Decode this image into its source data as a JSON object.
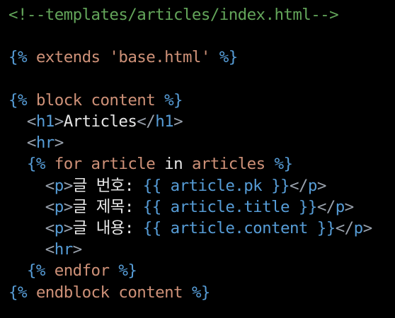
{
  "colors": {
    "background": "#000000",
    "comment": "#63a55a",
    "template_keyword": "#569cd6",
    "template_variable": "#ce9178",
    "html_tag": "#569cd6",
    "tag_bracket": "#9aa2ad",
    "plain_text": "#e6e6e6"
  },
  "code": {
    "lines": [
      {
        "tokens": [
          {
            "t": "<!--templates/articles/index.html-->",
            "k": "comment"
          }
        ]
      },
      {
        "tokens": []
      },
      {
        "tokens": [
          {
            "t": "{%",
            "k": "kw"
          },
          {
            "t": " extends ",
            "k": "var"
          },
          {
            "t": "'base.html'",
            "k": "var"
          },
          {
            "t": " %}",
            "k": "kw"
          }
        ]
      },
      {
        "tokens": []
      },
      {
        "tokens": [
          {
            "t": "{%",
            "k": "kw"
          },
          {
            "t": " block ",
            "k": "var"
          },
          {
            "t": "content",
            "k": "var"
          },
          {
            "t": " %}",
            "k": "kw"
          }
        ]
      },
      {
        "tokens": [
          {
            "t": "  ",
            "k": "text"
          },
          {
            "t": "<",
            "k": "bracket"
          },
          {
            "t": "h1",
            "k": "tag"
          },
          {
            "t": ">",
            "k": "bracket"
          },
          {
            "t": "Articles",
            "k": "text"
          },
          {
            "t": "</",
            "k": "bracket"
          },
          {
            "t": "h1",
            "k": "tag"
          },
          {
            "t": ">",
            "k": "bracket"
          }
        ]
      },
      {
        "tokens": [
          {
            "t": "  ",
            "k": "text"
          },
          {
            "t": "<",
            "k": "bracket"
          },
          {
            "t": "hr",
            "k": "tag"
          },
          {
            "t": ">",
            "k": "bracket"
          }
        ]
      },
      {
        "tokens": [
          {
            "t": "  ",
            "k": "text"
          },
          {
            "t": "{%",
            "k": "kw"
          },
          {
            "t": " for ",
            "k": "var"
          },
          {
            "t": "article",
            "k": "var"
          },
          {
            "t": " in ",
            "k": "text"
          },
          {
            "t": "articles",
            "k": "var"
          },
          {
            "t": " %}",
            "k": "kw"
          }
        ]
      },
      {
        "tokens": [
          {
            "t": "    ",
            "k": "text"
          },
          {
            "t": "<",
            "k": "bracket"
          },
          {
            "t": "p",
            "k": "tag"
          },
          {
            "t": ">",
            "k": "bracket"
          },
          {
            "t": "글 번호: ",
            "k": "text"
          },
          {
            "t": "{{",
            "k": "kw"
          },
          {
            "t": " article.pk ",
            "k": "kw"
          },
          {
            "t": "}}",
            "k": "kw"
          },
          {
            "t": "</",
            "k": "bracket"
          },
          {
            "t": "p",
            "k": "tag"
          },
          {
            "t": ">",
            "k": "bracket"
          }
        ]
      },
      {
        "tokens": [
          {
            "t": "    ",
            "k": "text"
          },
          {
            "t": "<",
            "k": "bracket"
          },
          {
            "t": "p",
            "k": "tag"
          },
          {
            "t": ">",
            "k": "bracket"
          },
          {
            "t": "글 제목: ",
            "k": "text"
          },
          {
            "t": "{{",
            "k": "kw"
          },
          {
            "t": " article.title ",
            "k": "kw"
          },
          {
            "t": "}}",
            "k": "kw"
          },
          {
            "t": "</",
            "k": "bracket"
          },
          {
            "t": "p",
            "k": "tag"
          },
          {
            "t": ">",
            "k": "bracket"
          }
        ]
      },
      {
        "tokens": [
          {
            "t": "    ",
            "k": "text"
          },
          {
            "t": "<",
            "k": "bracket"
          },
          {
            "t": "p",
            "k": "tag"
          },
          {
            "t": ">",
            "k": "bracket"
          },
          {
            "t": "글 내용: ",
            "k": "text"
          },
          {
            "t": "{{",
            "k": "kw"
          },
          {
            "t": " article.content ",
            "k": "kw"
          },
          {
            "t": "}}",
            "k": "kw"
          },
          {
            "t": "</",
            "k": "bracket"
          },
          {
            "t": "p",
            "k": "tag"
          },
          {
            "t": ">",
            "k": "bracket"
          }
        ]
      },
      {
        "tokens": [
          {
            "t": "    ",
            "k": "text"
          },
          {
            "t": "<",
            "k": "bracket"
          },
          {
            "t": "hr",
            "k": "tag"
          },
          {
            "t": ">",
            "k": "bracket"
          }
        ]
      },
      {
        "tokens": [
          {
            "t": "  ",
            "k": "text"
          },
          {
            "t": "{%",
            "k": "kw"
          },
          {
            "t": " endfor ",
            "k": "var"
          },
          {
            "t": "%}",
            "k": "kw"
          }
        ]
      },
      {
        "tokens": [
          {
            "t": "{%",
            "k": "kw"
          },
          {
            "t": " endblock ",
            "k": "var"
          },
          {
            "t": "content",
            "k": "var"
          },
          {
            "t": " %}",
            "k": "kw"
          }
        ]
      }
    ]
  }
}
